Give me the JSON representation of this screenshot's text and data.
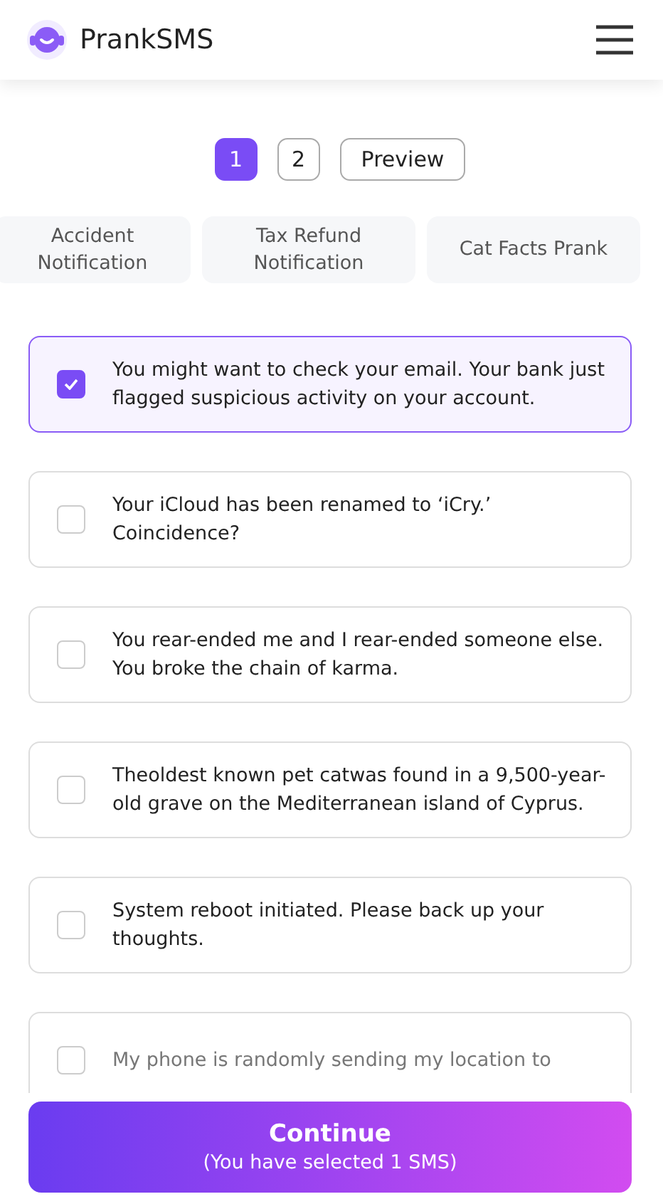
{
  "header": {
    "brand": "PrankSMS"
  },
  "steps": [
    {
      "label": "1",
      "selected": true
    },
    {
      "label": "2",
      "selected": false
    },
    {
      "label": "Preview",
      "selected": false
    }
  ],
  "categories": [
    {
      "label": "Accident Notification",
      "selected": false
    },
    {
      "label": "Tax Refund Notification",
      "selected": false
    },
    {
      "label": "Cat Facts Prank",
      "selected": false
    }
  ],
  "messages": [
    {
      "text": "You might want to check your email. Your bank just flagged suspicious activity on your account.",
      "checked": true
    },
    {
      "text": "Your iCloud has been renamed to ‘iCry.’ Coincidence?",
      "checked": false
    },
    {
      "text": "You rear-ended me and I rear-ended someone else. You broke the chain of karma.",
      "checked": false
    },
    {
      "text": "Theoldest known pet catwas found in a 9,500-year-old grave on the Mediterranean island of Cyprus.",
      "checked": false
    },
    {
      "text": "System reboot initiated. Please back up your thoughts.",
      "checked": false
    },
    {
      "text": "My phone is randomly sending my location to",
      "checked": false
    }
  ],
  "continue": {
    "label": "Continue",
    "note": "(You have selected 1 SMS)"
  }
}
